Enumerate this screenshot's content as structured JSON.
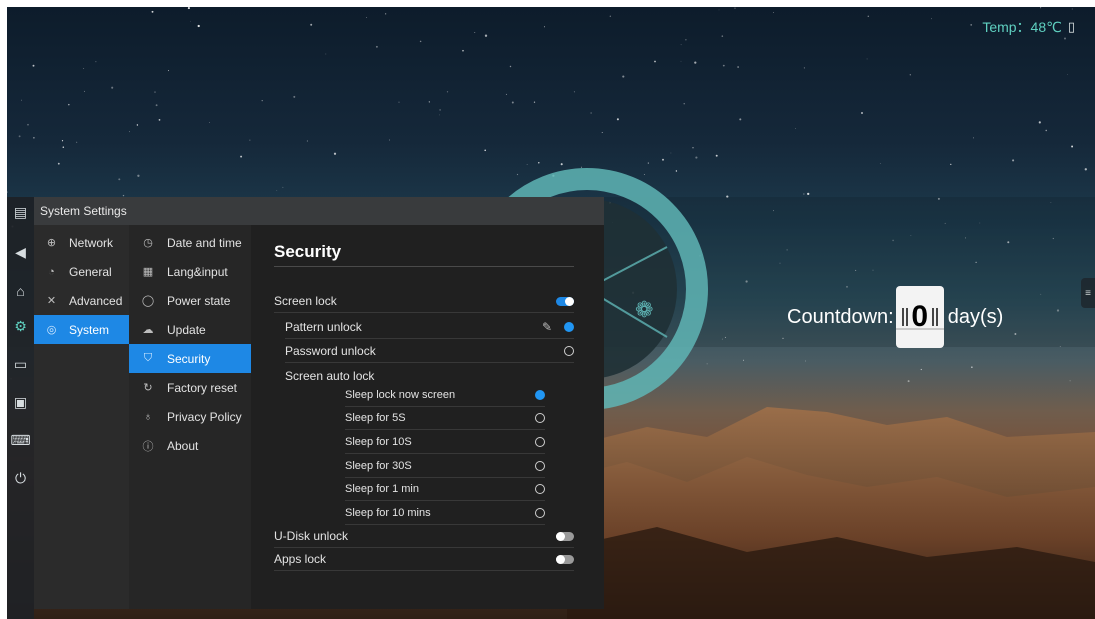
{
  "status": {
    "temp_label": "Temp：48℃",
    "temp_icon": "usb-icon"
  },
  "countdown": {
    "label": "Countdown:",
    "value": "0",
    "unit": "day(s)"
  },
  "left_bar": {
    "icons": [
      "window-list-icon",
      "back-icon",
      "home-icon",
      "settings-icon",
      "folder-icon",
      "screen-capture-icon",
      "keyboard-icon",
      "power-icon"
    ]
  },
  "window": {
    "title": "System Settings",
    "categories": [
      {
        "label": "Network",
        "icon": "globe-icon"
      },
      {
        "label": "General",
        "icon": "palette-icon"
      },
      {
        "label": "Advanced",
        "icon": "tools-icon"
      },
      {
        "label": "System",
        "icon": "system-icon",
        "active": true
      }
    ],
    "subitems": [
      {
        "label": "Date and time",
        "icon": "clock-icon"
      },
      {
        "label": "Lang&input",
        "icon": "keyboard-icon"
      },
      {
        "label": "Power state",
        "icon": "power-icon"
      },
      {
        "label": "Update",
        "icon": "cloud-icon"
      },
      {
        "label": "Security",
        "icon": "shield-icon",
        "active": true
      },
      {
        "label": "Factory reset",
        "icon": "reset-icon"
      },
      {
        "label": "Privacy Policy",
        "icon": "privacy-icon"
      },
      {
        "label": "About",
        "icon": "info-icon"
      }
    ],
    "security": {
      "title": "Security",
      "screen_lock": {
        "label": "Screen lock",
        "enabled": true
      },
      "pattern_unlock": {
        "label": "Pattern unlock",
        "selected": true
      },
      "password_unlock": {
        "label": "Password unlock",
        "selected": false
      },
      "auto_lock": {
        "label": "Screen auto lock",
        "options": [
          {
            "label": "Sleep lock now screen",
            "selected": true
          },
          {
            "label": "Sleep for 5S",
            "selected": false
          },
          {
            "label": "Sleep for 10S",
            "selected": false
          },
          {
            "label": "Sleep for 30S",
            "selected": false
          },
          {
            "label": "Sleep for 1 min",
            "selected": false
          },
          {
            "label": "Sleep for 10 mins",
            "selected": false
          }
        ]
      },
      "udisk_unlock": {
        "label": "U-Disk unlock",
        "enabled": false
      },
      "apps_lock": {
        "label": "Apps lock",
        "enabled": false
      }
    }
  },
  "colors": {
    "accent": "#1e88e5",
    "temp_text": "#5fd0c0",
    "panel": "#252525"
  }
}
